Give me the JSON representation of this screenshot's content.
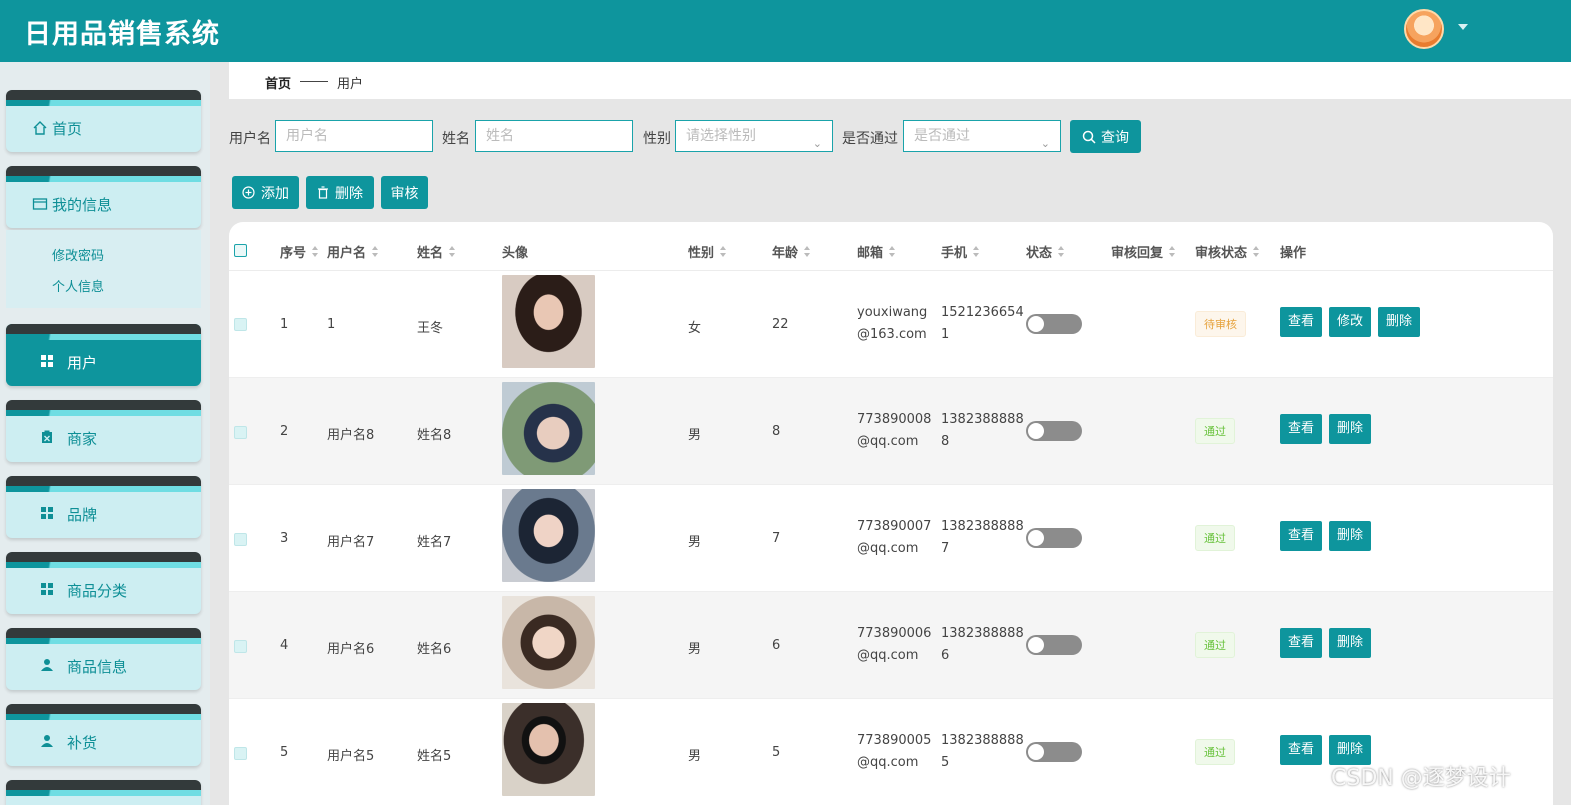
{
  "app": {
    "title": "日用品销售系统"
  },
  "colors": {
    "primary": "#0e959d",
    "pending": "#e6a23c",
    "pass": "#67c23a"
  },
  "sidebar": {
    "home": {
      "label": "首页",
      "icon": "home-icon"
    },
    "myinfo": {
      "label": "我的信息",
      "icon": "card-icon",
      "children": [
        "修改密码",
        "个人信息"
      ]
    },
    "items": [
      {
        "label": "用户",
        "icon": "grid-icon",
        "active": true
      },
      {
        "label": "商家",
        "icon": "clipboard-icon"
      },
      {
        "label": "品牌",
        "icon": "grid-icon"
      },
      {
        "label": "商品分类",
        "icon": "grid-icon"
      },
      {
        "label": "商品信息",
        "icon": "user-icon"
      },
      {
        "label": "补货",
        "icon": "user-icon"
      }
    ]
  },
  "breadcrumb": {
    "home": "首页",
    "current": "用户"
  },
  "search": {
    "username_label": "用户名",
    "username_placeholder": "用户名",
    "name_label": "姓名",
    "name_placeholder": "姓名",
    "gender_label": "性别",
    "gender_placeholder": "请选择性别",
    "pass_label": "是否通过",
    "pass_placeholder": "是否通过",
    "query_button": "查询"
  },
  "toolbar": {
    "add": "添加",
    "delete": "删除",
    "review": "审核"
  },
  "table": {
    "columns": [
      "序号",
      "用户名",
      "姓名",
      "头像",
      "性别",
      "年龄",
      "邮箱",
      "手机",
      "状态",
      "审核回复",
      "审核状态",
      "操作"
    ],
    "rows": [
      {
        "index": "1",
        "username": "1",
        "name": "王冬",
        "gender": "女",
        "age": "22",
        "email1": "youxiwang",
        "email2": "@163.com",
        "phone1": "1521236654",
        "phone2": "1",
        "status": "待审核",
        "status_type": "pending",
        "actions": [
          "查看",
          "修改",
          "删除"
        ]
      },
      {
        "index": "2",
        "username": "用户名8",
        "name": "姓名8",
        "gender": "男",
        "age": "8",
        "email1": "773890008",
        "email2": "@qq.com",
        "phone1": "1382388888",
        "phone2": "8",
        "status": "通过",
        "status_type": "pass",
        "actions": [
          "查看",
          "删除"
        ]
      },
      {
        "index": "3",
        "username": "用户名7",
        "name": "姓名7",
        "gender": "男",
        "age": "7",
        "email1": "773890007",
        "email2": "@qq.com",
        "phone1": "1382388888",
        "phone2": "7",
        "status": "通过",
        "status_type": "pass",
        "actions": [
          "查看",
          "删除"
        ]
      },
      {
        "index": "4",
        "username": "用户名6",
        "name": "姓名6",
        "gender": "男",
        "age": "6",
        "email1": "773890006",
        "email2": "@qq.com",
        "phone1": "1382388888",
        "phone2": "6",
        "status": "通过",
        "status_type": "pass",
        "actions": [
          "查看",
          "删除"
        ]
      },
      {
        "index": "5",
        "username": "用户名5",
        "name": "姓名5",
        "gender": "男",
        "age": "5",
        "email1": "773890005",
        "email2": "@qq.com",
        "phone1": "1382388888",
        "phone2": "5",
        "status": "通过",
        "status_type": "pass",
        "actions": [
          "查看",
          "删除"
        ]
      }
    ]
  },
  "watermark": "CSDN @逐梦设计"
}
